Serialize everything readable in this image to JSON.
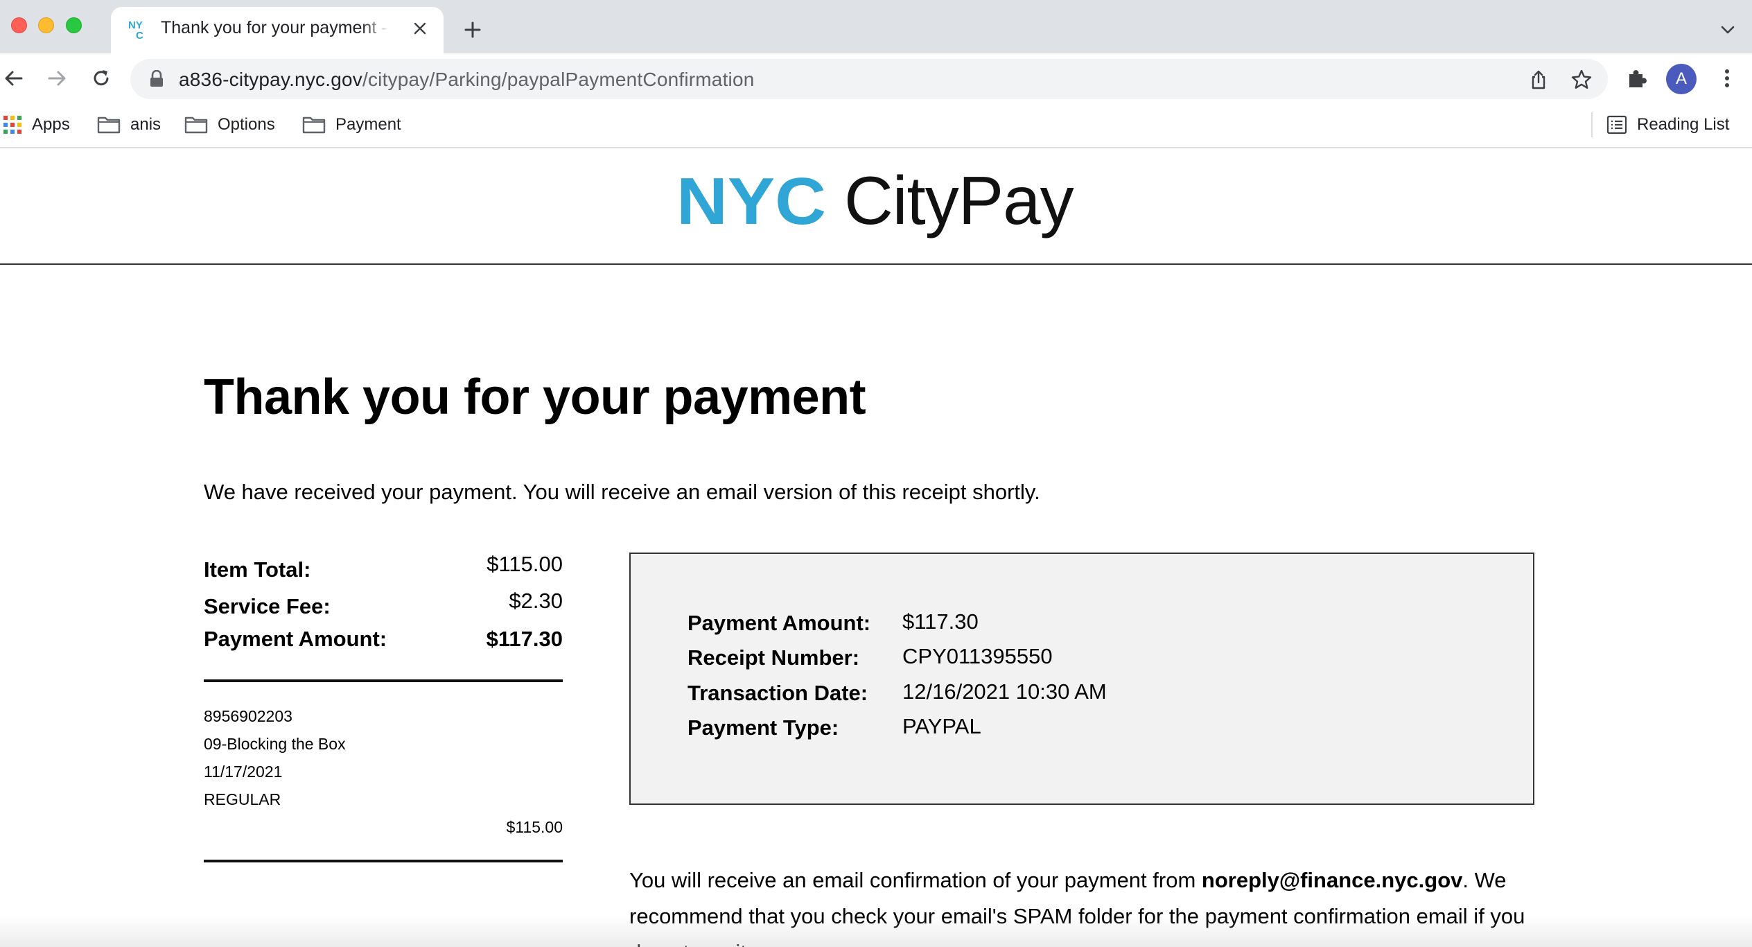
{
  "browser": {
    "tab": {
      "title": "Thank you for your payment - NYC CityPay",
      "favicon": "nyc-icon"
    },
    "address_bar": {
      "host": "a836-citypay.nyc.gov",
      "path": "/citypay/Parking/paypalPaymentConfirmation"
    },
    "profile_initial": "A",
    "bookmarks": [
      {
        "label": "Apps",
        "icon": "apps-grid-icon"
      },
      {
        "label": "anis",
        "icon": "folder-icon"
      },
      {
        "label": "Options",
        "icon": "folder-icon"
      },
      {
        "label": "Payment",
        "icon": "folder-icon"
      }
    ],
    "reading_list": "Reading List"
  },
  "header": {
    "logo_mark": "NYC",
    "logo_text": "CityPay",
    "brand_color": "#2fa6d6"
  },
  "main": {
    "title": "Thank you for your payment",
    "intro": "We have received your payment. You will receive an email version of this receipt shortly.",
    "summary": {
      "item_total_label": "Item Total:",
      "item_total": "$115.00",
      "service_fee_label": "Service Fee:",
      "service_fee": "$2.30",
      "payment_amount_label": "Payment Amount:",
      "payment_amount": "$117.30"
    },
    "item": {
      "number": "8956902203",
      "violation": "09-Blocking the Box",
      "date": "11/17/2021",
      "type": "REGULAR",
      "amount": "$115.00"
    },
    "receipt": {
      "payment_amount_label": "Payment Amount:",
      "payment_amount": "$117.30",
      "receipt_number_label": "Receipt Number:",
      "receipt_number": "CPY011395550",
      "transaction_date_label": "Transaction Date:",
      "transaction_date": "12/16/2021 10:30 AM",
      "payment_type_label": "Payment Type:",
      "payment_type": "PAYPAL"
    },
    "confirmation": {
      "text_before": "You will receive an email confirmation of your payment from ",
      "email": "noreply@finance.nyc.gov",
      "text_after": ". We recommend that you check your email's SPAM folder for the payment confirmation email if you do not see it."
    }
  }
}
